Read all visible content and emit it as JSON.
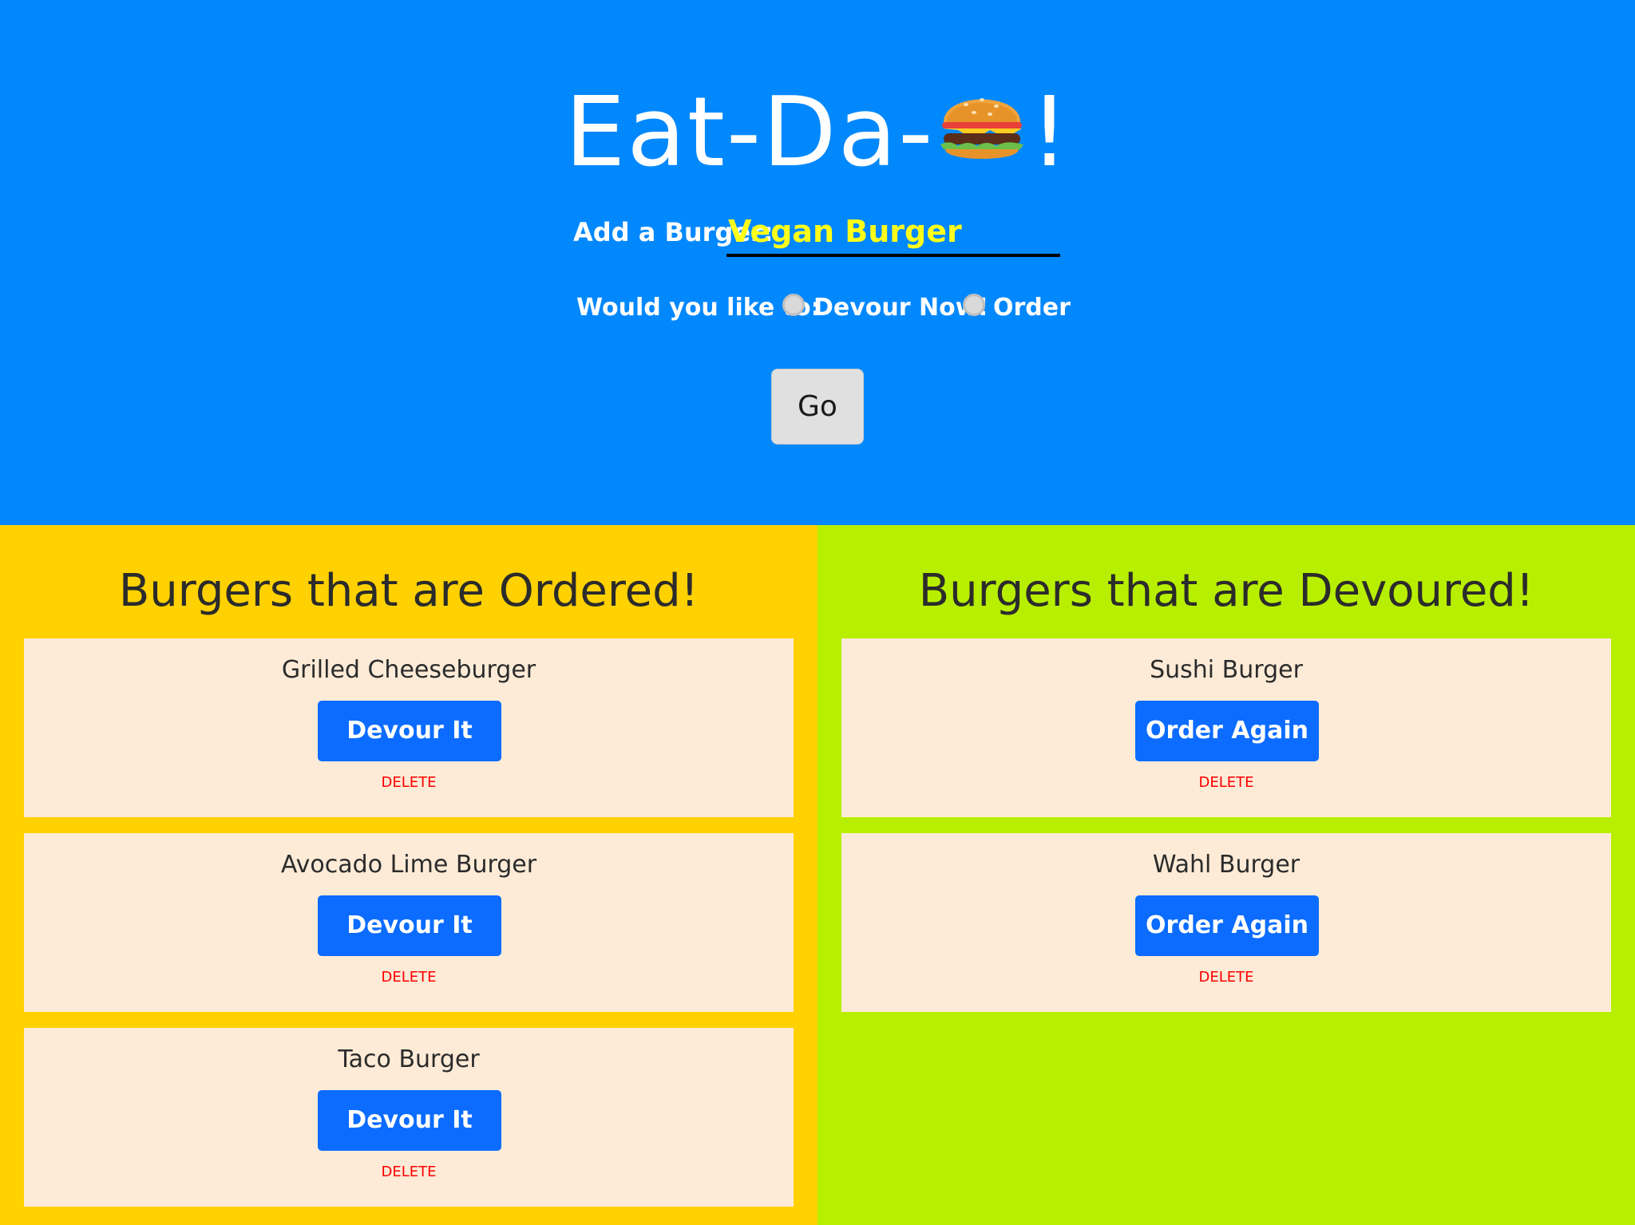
{
  "colors": {
    "header_bg": "#0288fd",
    "ordered_bg": "#ffd100",
    "devoured_bg": "#b8ef00",
    "card_bg": "#fdebd7",
    "button_bg": "#0b6cff",
    "delete_color": "#ff0000",
    "input_text_color": "#ffff1a"
  },
  "header": {
    "title_prefix": "Eat-Da-",
    "title_icon": "hamburger-emoji",
    "title_suffix": "!",
    "add_label": "Add a Burger:",
    "add_value": "Vegan Burger",
    "choice_prompt": "Would you like to:",
    "choice_devour": "Devour Now!",
    "choice_order": "Order",
    "go_label": "Go"
  },
  "ordered": {
    "title": "Burgers that are Ordered!",
    "items": [
      {
        "name": "Grilled Cheeseburger",
        "action": "Devour It",
        "delete": "DELETE"
      },
      {
        "name": "Avocado Lime Burger",
        "action": "Devour It",
        "delete": "DELETE"
      },
      {
        "name": "Taco Burger",
        "action": "Devour It",
        "delete": "DELETE"
      }
    ]
  },
  "devoured": {
    "title": "Burgers that are Devoured!",
    "items": [
      {
        "name": "Sushi Burger",
        "action": "Order Again",
        "delete": "DELETE"
      },
      {
        "name": "Wahl Burger",
        "action": "Order Again",
        "delete": "DELETE"
      }
    ]
  }
}
